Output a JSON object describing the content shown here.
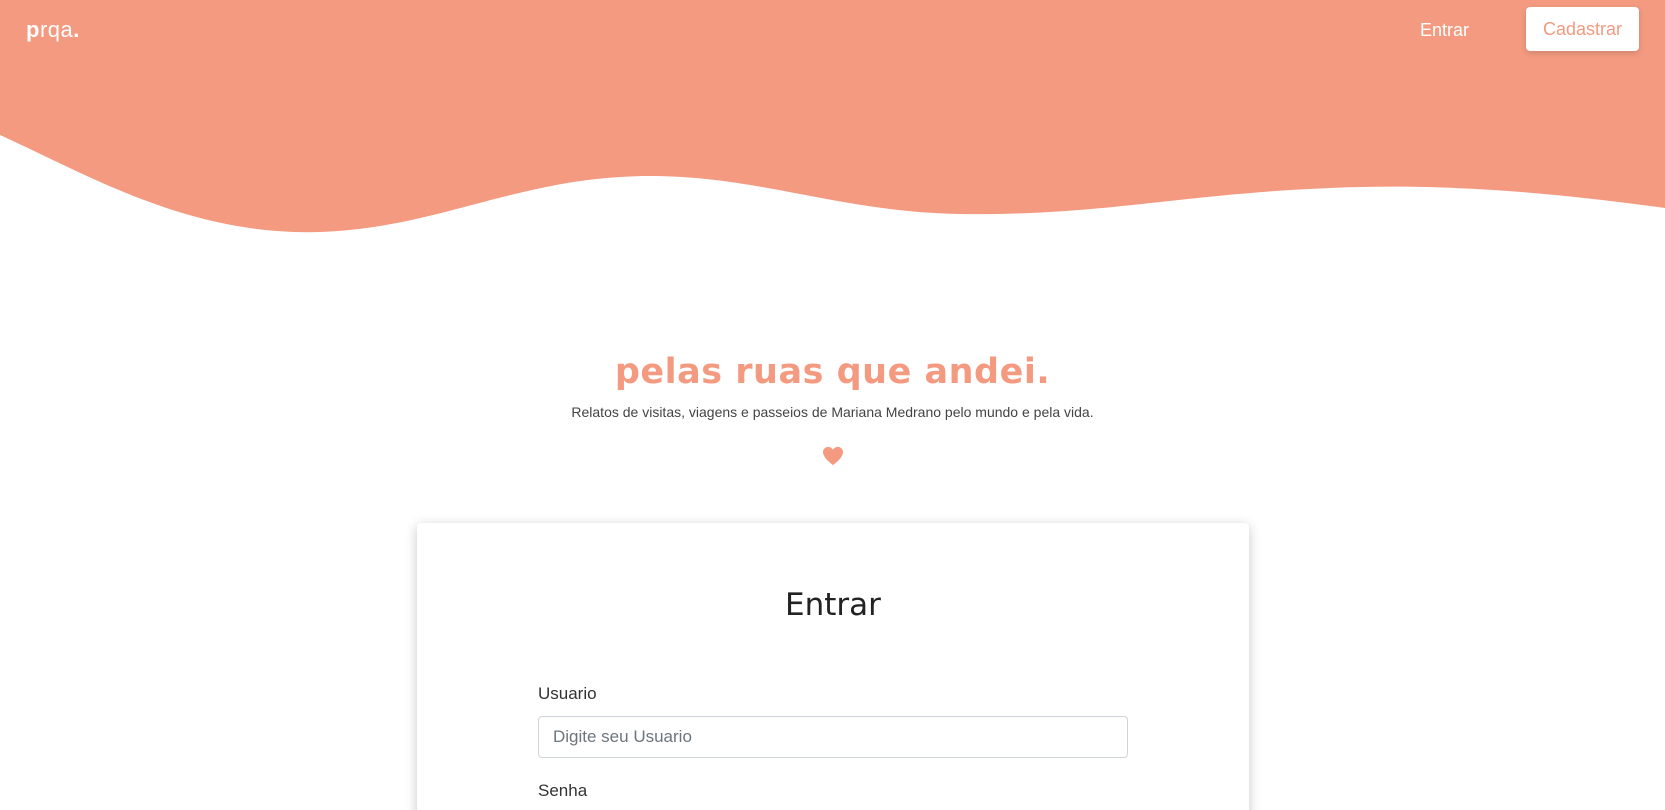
{
  "colors": {
    "accent": "#f39a80",
    "background": "#ffffff",
    "text": "#333333"
  },
  "navbar": {
    "brand_bold": "p",
    "brand_rest": "rqa",
    "brand_dot": ".",
    "login_link": "Entrar",
    "signup_button": "Cadastrar"
  },
  "hero": {
    "title_first": "p",
    "title_rest": "elas ruas que andei",
    "title_dot": ".",
    "subtitle": "Relatos de visitas, viagens e passeios de Mariana Medrano pelo mundo e pela vida.",
    "icon": "heart-icon"
  },
  "login_card": {
    "title": "Entrar",
    "username_label": "Usuario",
    "username_placeholder": "Digite seu Usuario",
    "username_value": "",
    "password_label": "Senha"
  }
}
